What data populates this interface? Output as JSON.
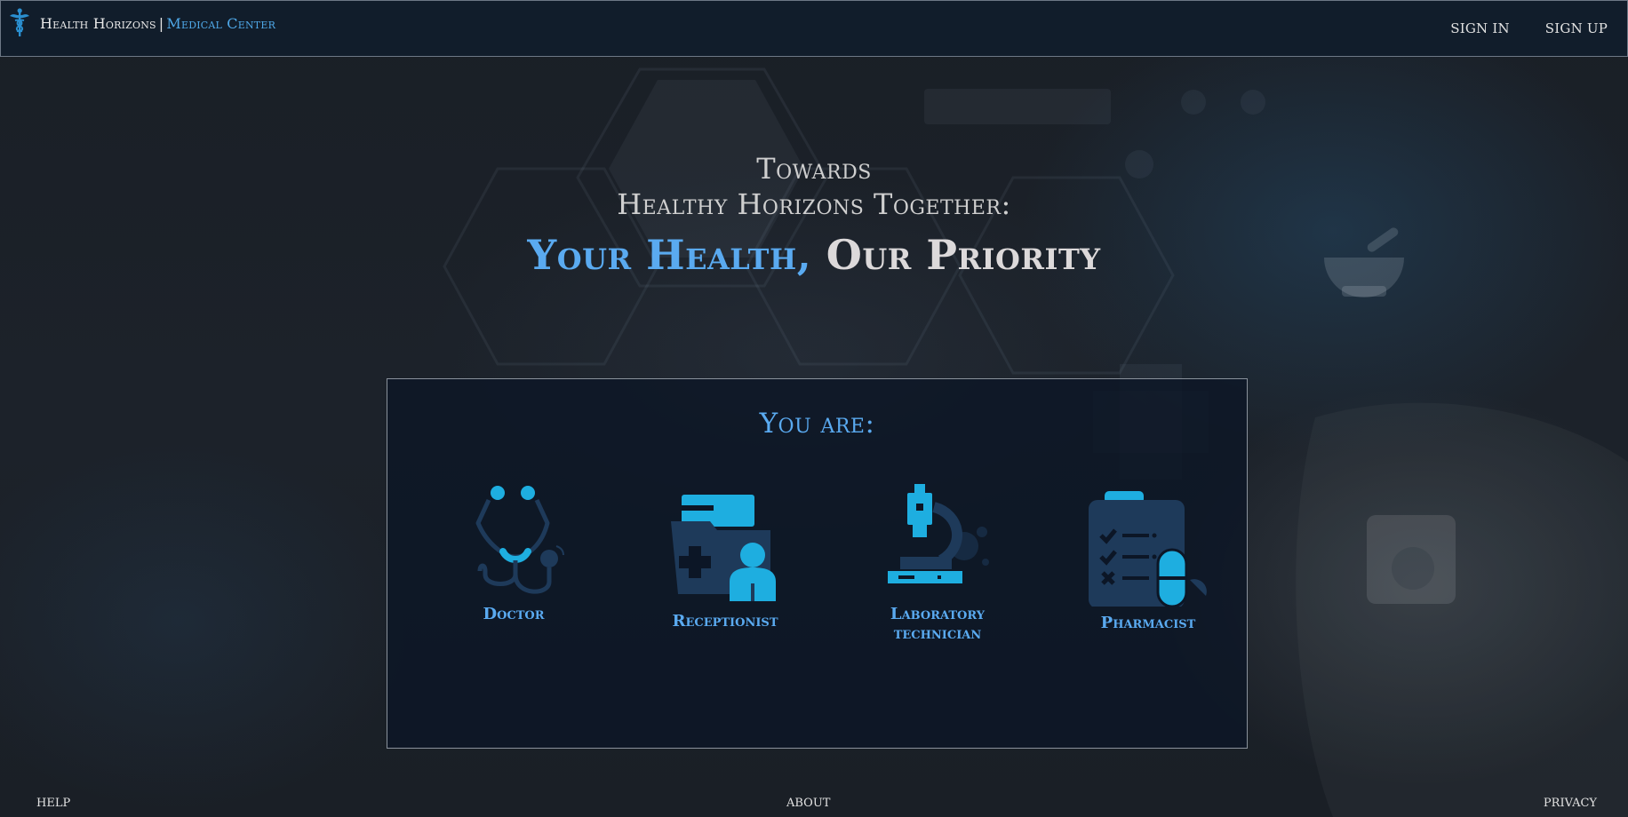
{
  "header": {
    "brand_name": "Health Horizons",
    "brand_separator": "|",
    "brand_subtitle": "Medical Center",
    "nav": {
      "sign_in": "SIGN IN",
      "sign_up": "SIGN UP"
    }
  },
  "hero": {
    "line1": "Towards",
    "line2": "Healthy Horizons Together:",
    "headline_accent": "Your Health,",
    "headline_rest": "Our Priority"
  },
  "roles_panel": {
    "title": "You are:",
    "roles": [
      {
        "label": "Doctor",
        "icon": "stethoscope-icon"
      },
      {
        "label": "Receptionist",
        "icon": "medical-records-icon"
      },
      {
        "label_line1": "Laboratory",
        "label_line2": "technician",
        "icon": "microscope-icon"
      },
      {
        "label": "Pharmacist",
        "icon": "prescription-clipboard-icon"
      }
    ]
  },
  "footer": {
    "help": "HELP",
    "about": "ABOUT",
    "privacy": "PRIVACY"
  },
  "colors": {
    "accent": "#5aaaf0",
    "icon_light": "#1eaee0",
    "icon_dark": "#1e3a5a",
    "header_bg": "#111d2b",
    "panel_bg": "#0c1626"
  }
}
